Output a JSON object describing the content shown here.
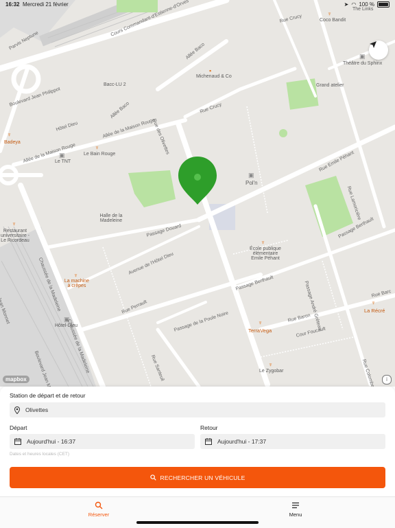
{
  "status_bar": {
    "time": "16:32",
    "date": "Mercredi 21 février",
    "battery": "100 %"
  },
  "map": {
    "streets": [
      "Cours Commandant-d'Estienne-d'Orves",
      "Parvis Neptune",
      "Allée Baco",
      "Allée Baco",
      "Boulevard Jean Philippot",
      "Hôtel Dieu",
      "Allée de la Maison Rouge",
      "Allée de la Maison Rouge",
      "Rue des Olivettes",
      "Rue Crucy",
      "Rue Emile Péhant",
      "Rue Lamoricière",
      "Passage Douard",
      "Chaussée de la Madeleine",
      "Avenue de l'Hôtel Dieu",
      "Passage Berthault",
      "Passage Berthault",
      "Passage André Gréteau",
      "Rue Perrault",
      "Passage de la Poule Noire",
      "Rue Baron",
      "Cour Foucault",
      "Rue Santeuil",
      "Chaussée de la Madeleine",
      "Boulevard Jean Monnet",
      "Jean Monnet",
      "Rue Colombelle",
      "Rue Barc",
      "Rue Crucy"
    ],
    "places": {
      "the_links": "The Links",
      "coco_bandit": "Coco Bandit",
      "theatre_sphinx": "Théâtre du Sphinx",
      "michenaud": "Michenaud & Co",
      "bacc": "Bacc-LU 2",
      "grand_atelier": "Grand atelier",
      "badeya": "Badeya",
      "le_bain_rouge": "Le Bain Rouge",
      "le_tnt": "Le TNT",
      "pol_n": "Pol'n",
      "halle": "Halle de la Madeleine",
      "restaurant_univ": "Restaurant universitaire - Le Ricordeau",
      "ecole": "École publique élémentaire Emile Péhant",
      "machine_crepes": "La machine à crêpes",
      "hotel_dieu": "Hôtel-Dieu",
      "terravega": "TerraVega",
      "la_recre": "La Récré",
      "le_zygobar": "Le Zygobar"
    },
    "attribution": "mapbox",
    "info": "i",
    "pin_color": "#2e9e2a",
    "park_color": "#b9e2a2"
  },
  "form": {
    "station_label": "Station de départ et de retour",
    "station_value": "Olivettes",
    "depart_label": "Départ",
    "depart_value": "Aujourd'hui - 16:37",
    "retour_label": "Retour",
    "retour_value": "Aujourd'hui - 17:37",
    "tz_hint": "Dates et heures locales (CET)",
    "cta": "RECHERCHER UN VÉHICULE",
    "accent_color": "#f4560c"
  },
  "tabs": {
    "reserver": "Réserver",
    "menu": "Menu"
  }
}
